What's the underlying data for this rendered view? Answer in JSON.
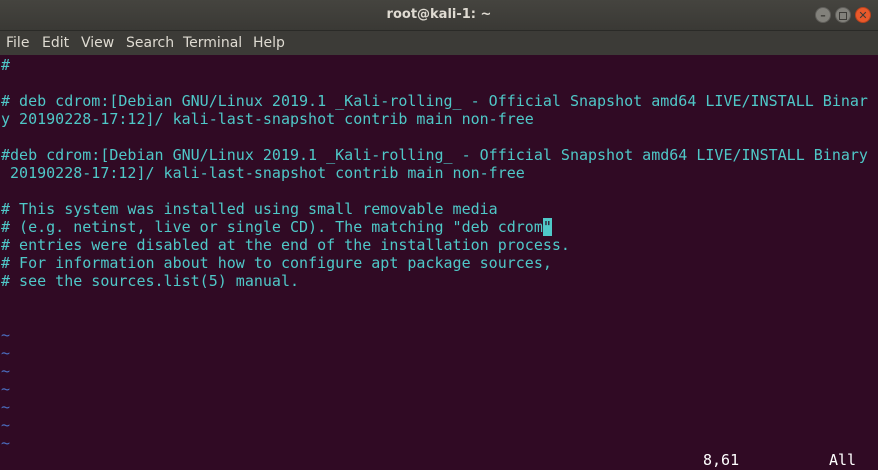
{
  "window": {
    "title": "root@kali-1: ~",
    "min_symbol": "–",
    "close_symbol": "✕"
  },
  "menu": {
    "items": [
      "File",
      "Edit",
      "View",
      "Search",
      "Terminal",
      "Help"
    ]
  },
  "terminal": {
    "lines": [
      "#",
      "",
      "# deb cdrom:[Debian GNU/Linux 2019.1 _Kali-rolling_ - Official Snapshot amd64 LIVE/INSTALL Binar",
      "y 20190228-17:12]/ kali-last-snapshot contrib main non-free",
      "",
      "#deb cdrom:[Debian GNU/Linux 2019.1 _Kali-rolling_ - Official Snapshot amd64 LIVE/INSTALL Binary",
      " 20190228-17:12]/ kali-last-snapshot contrib main non-free",
      "",
      "# This system was installed using small removable media",
      "# (e.g. netinst, live or single CD). The matching \"deb cdrom",
      "# entries were disabled at the end of the installation process.",
      "# For information about how to configure apt package sources,",
      "# see the sources.list(5) manual."
    ],
    "cursor_char": "\"",
    "tildes": [
      "~",
      "~",
      "~",
      "~",
      "~",
      "~",
      "~"
    ],
    "status_position": "8,61",
    "status_scroll": "All"
  },
  "colors": {
    "background": "#300a24",
    "text": "#4fc8c8",
    "tilde": "#4b6ec0",
    "titlebar": "#3c3b37",
    "close_button": "#e9592b"
  }
}
